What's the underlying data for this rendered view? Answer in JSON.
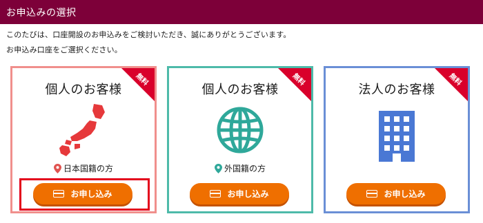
{
  "header": {
    "title": "お申込みの選択"
  },
  "intro": {
    "line1": "このたびは、口座開設のお申込みをご検討いただき、誠にありがとうございます。",
    "line2": "お申込み口座をご選択ください。"
  },
  "cards": [
    {
      "badge": "無料",
      "title": "個人のお客様",
      "subtitle": "日本国籍の方",
      "icon": "japan-map-icon",
      "button_label": "お申し込み",
      "border_color": "#f08f8c",
      "highlighted": true
    },
    {
      "badge": "無料",
      "title": "個人のお客様",
      "subtitle": "外国籍の方",
      "icon": "globe-icon",
      "button_label": "お申し込み",
      "border_color": "#4dbaa9",
      "highlighted": false
    },
    {
      "badge": "無料",
      "title": "法人のお客様",
      "icon": "building-icon",
      "button_label": "お申し込み",
      "border_color": "#6a8fd6",
      "highlighted": false
    }
  ],
  "colors": {
    "header_bg": "#7d0039",
    "button": "#ef6f00",
    "badge": "#d9002b",
    "highlight": "#e3001b",
    "pin_red": "#e05350",
    "pin_teal": "#2fa89a",
    "japan_red": "#e6393b",
    "globe_teal": "#2fa89a",
    "building_blue": "#4a78d4"
  }
}
